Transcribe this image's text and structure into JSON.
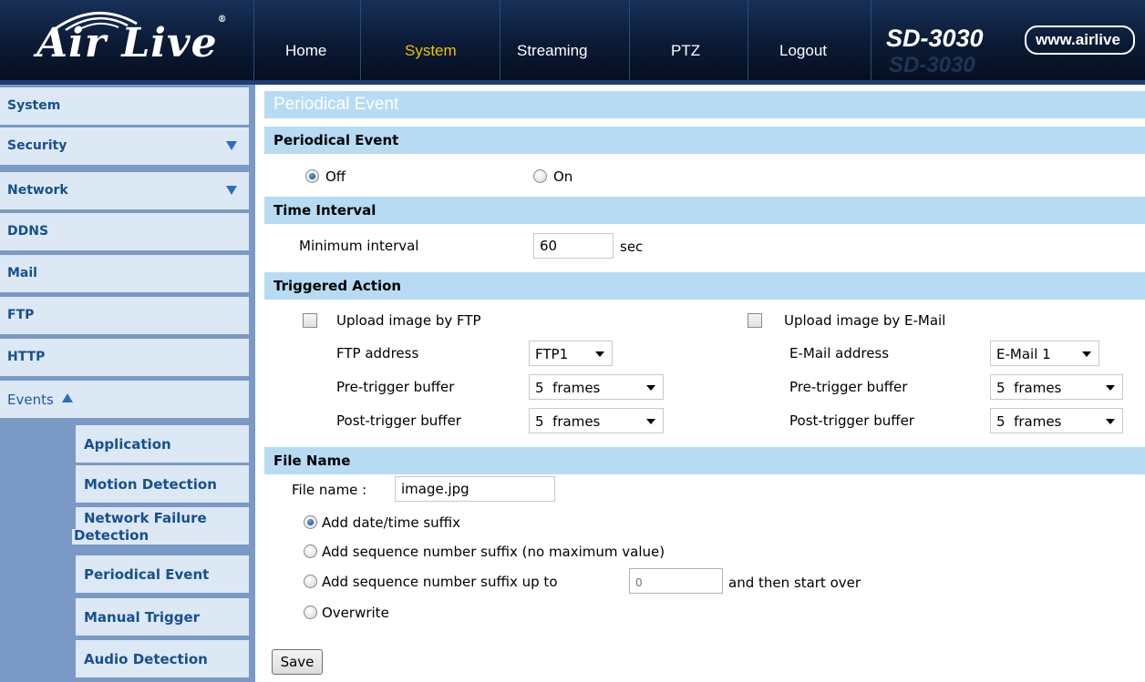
{
  "header": {
    "logo_text": "Air Live",
    "logo_mark": "®",
    "nav": [
      "Home",
      "System",
      "Streaming",
      "PTZ",
      "Logout"
    ],
    "active_nav": "System",
    "model": "SD-3030",
    "url_badge": "www.airlive"
  },
  "sidebar": {
    "items": [
      {
        "label": "System"
      },
      {
        "label": "Security",
        "icon": "triangle-down-icon"
      },
      {
        "label": "Network",
        "icon": "triangle-down-icon"
      },
      {
        "label": "DDNS"
      },
      {
        "label": "Mail"
      },
      {
        "label": "FTP"
      },
      {
        "label": "HTTP"
      },
      {
        "label": "Events",
        "icon": "triangle-up-icon"
      }
    ],
    "sub_items": [
      {
        "label": "Application"
      },
      {
        "label": "Motion Detection"
      },
      {
        "label_line1": "Network Failure",
        "label_line2": "Detection"
      },
      {
        "label": "Periodical Event"
      },
      {
        "label": "Manual Trigger"
      },
      {
        "label": "Audio Detection"
      }
    ]
  },
  "page": {
    "title": "Periodical Event",
    "periodical_event": {
      "heading": "Periodical Event",
      "off_label": "Off",
      "on_label": "On",
      "selected": "Off"
    },
    "time_interval": {
      "heading": "Time Interval",
      "min_interval_label": "Minimum interval",
      "min_interval_value": "60",
      "unit": "sec"
    },
    "triggered_action": {
      "heading": "Triggered Action",
      "ftp": {
        "upload_label": "Upload image by FTP",
        "checked": false,
        "address_label": "FTP address",
        "address_value": "FTP1",
        "pre_label": "Pre-trigger buffer",
        "pre_value": "5  frames",
        "post_label": "Post-trigger buffer",
        "post_value": "5  frames"
      },
      "email": {
        "upload_label": "Upload image by E-Mail",
        "checked": false,
        "address_label": "E-Mail address",
        "address_value": "E-Mail 1",
        "pre_label": "Pre-trigger buffer",
        "pre_value": "5  frames",
        "post_label": "Post-trigger buffer",
        "post_value": "5  frames"
      }
    },
    "file_name": {
      "heading": "File Name",
      "label": "File name :",
      "value": "image.jpg",
      "options": [
        "Add date/time suffix",
        "Add sequence number suffix (no maximum value)",
        "Add sequence number suffix up to",
        "Overwrite"
      ],
      "selected_index": 0,
      "seq_max_placeholder": "0",
      "seq_after_text": "and then start over"
    },
    "save_label": "Save"
  },
  "colors": {
    "header_bg": "#0b1b36",
    "active_nav": "#f2c200",
    "section_bar": "#b7dbf3",
    "sidebar_bg": "#7a99c4",
    "sidebar_item_bg": "#dde8f5",
    "sidebar_text": "#16508f"
  }
}
